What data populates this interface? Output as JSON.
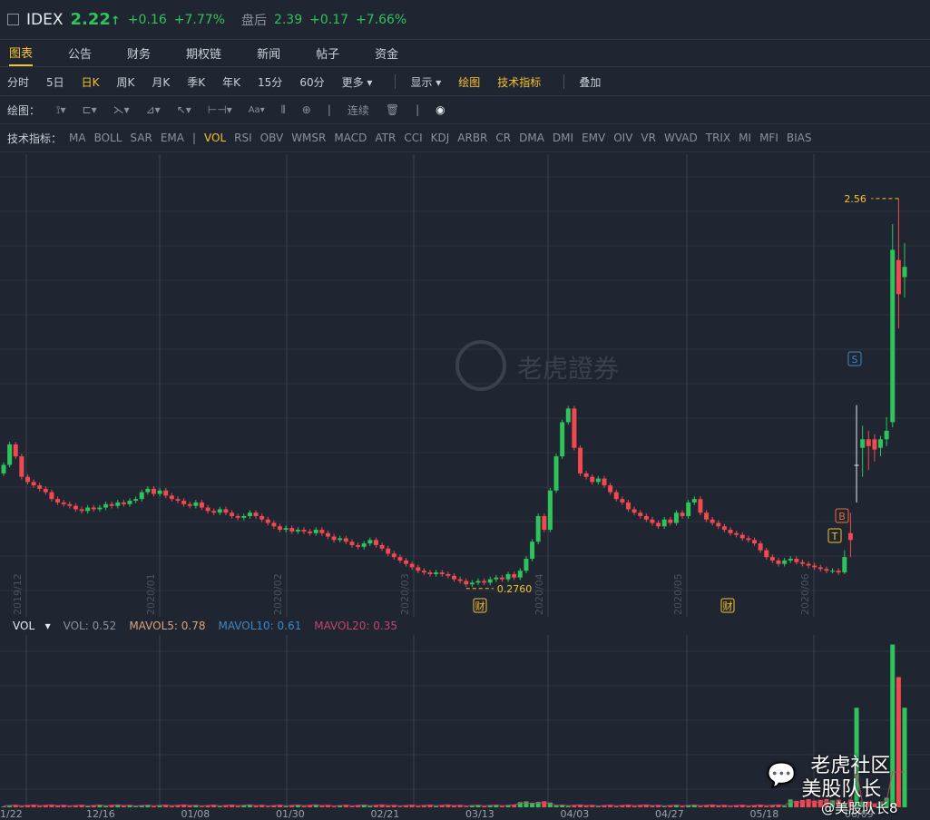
{
  "header": {
    "symbol": "IDEX",
    "price": "2.22",
    "arrow": "↑",
    "change": "+0.16",
    "pct": "+7.77%",
    "after_label": "盘后",
    "after_price": "2.39",
    "after_change": "+0.17",
    "after_pct": "+7.66%"
  },
  "tabs": [
    "图表",
    "公告",
    "财务",
    "期权链",
    "新闻",
    "帖子",
    "资金"
  ],
  "periods": [
    "分时",
    "5日",
    "日K",
    "周K",
    "月K",
    "季K",
    "年K",
    "15分",
    "60分",
    "更多 ▾"
  ],
  "display": [
    "显示 ▾",
    "绘图",
    "技术指标"
  ],
  "overlay": "叠加",
  "draw": {
    "label": "绘图：",
    "continuous": "连续",
    "icons": [
      "vertical-line-icon",
      "rectangle-icon",
      "fib-icon",
      "channel-icon",
      "arrow-icon",
      "measure-icon",
      "text-icon",
      "candle-icon",
      "zoom-icon",
      "trash-icon",
      "eye-icon"
    ]
  },
  "indicators": {
    "label": "技术指标：",
    "items": [
      "MA",
      "BOLL",
      "SAR",
      "EMA",
      "|",
      "VOL",
      "RSI",
      "OBV",
      "WMSR",
      "MACD",
      "ATR",
      "CCI",
      "KDJ",
      "ARBR",
      "CR",
      "DMA",
      "DMI",
      "EMV",
      "OIV",
      "VR",
      "WVAD",
      "TRIX",
      "MI",
      "MFI",
      "BIAS"
    ],
    "active": "VOL"
  },
  "vol_legend": {
    "name": "VOL",
    "vol": "VOL: 0.52",
    "mavol5": "MAVOL5: 0.78",
    "mavol10": "MAVOL10: 0.61",
    "mavol20": "MAVOL20: 0.35"
  },
  "watermark": "老虎證券",
  "overlay_watermark": {
    "line1": "老虎社区",
    "line2": "美股队长",
    "line3": "@美股队长8"
  },
  "colors": {
    "up": "#2fc35b",
    "down": "#f0494f",
    "accent": "#f5c12e",
    "mavol5": "#d9a37a",
    "mavol10": "#3f86c4",
    "mavol20": "#c2456f"
  },
  "chart_data": {
    "type": "candlestick",
    "ylim": [
      0.11,
      2.82
    ],
    "grid": true,
    "month_labels": [
      "2019/12",
      "2020/01",
      "2020/02",
      "2020/03",
      "2020/04",
      "2020/05",
      "2020/06"
    ],
    "x_ticks": [
      "1/22",
      "12/16",
      "01/08",
      "01/30",
      "02/21",
      "03/13",
      "04/03",
      "04/27",
      "05/18",
      "06/09"
    ],
    "high_label": "2.56",
    "low_label": "0.2760",
    "markers": [
      {
        "text": "财",
        "at": "03"
      },
      {
        "text": "财",
        "at": "05"
      },
      {
        "text": "T"
      },
      {
        "text": "B"
      },
      {
        "text": "S"
      }
    ],
    "close": [
      1.0,
      1.12,
      1.05,
      0.93,
      0.9,
      0.88,
      0.86,
      0.84,
      0.8,
      0.78,
      0.77,
      0.76,
      0.74,
      0.73,
      0.75,
      0.74,
      0.75,
      0.77,
      0.76,
      0.78,
      0.77,
      0.79,
      0.8,
      0.84,
      0.86,
      0.83,
      0.85,
      0.82,
      0.8,
      0.79,
      0.77,
      0.76,
      0.78,
      0.75,
      0.73,
      0.72,
      0.74,
      0.72,
      0.7,
      0.69,
      0.7,
      0.72,
      0.7,
      0.68,
      0.66,
      0.64,
      0.62,
      0.63,
      0.61,
      0.62,
      0.61,
      0.6,
      0.62,
      0.6,
      0.58,
      0.56,
      0.57,
      0.55,
      0.53,
      0.52,
      0.54,
      0.56,
      0.53,
      0.51,
      0.48,
      0.46,
      0.44,
      0.42,
      0.4,
      0.38,
      0.37,
      0.36,
      0.37,
      0.36,
      0.35,
      0.33,
      0.32,
      0.3,
      0.31,
      0.32,
      0.31,
      0.33,
      0.34,
      0.33,
      0.36,
      0.34,
      0.38,
      0.45,
      0.55,
      0.7,
      0.62,
      0.85,
      1.05,
      1.25,
      1.33,
      1.1,
      0.95,
      0.93,
      0.9,
      0.92,
      0.88,
      0.84,
      0.8,
      0.78,
      0.74,
      0.72,
      0.7,
      0.68,
      0.66,
      0.64,
      0.68,
      0.66,
      0.72,
      0.7,
      0.78,
      0.8,
      0.72,
      0.68,
      0.66,
      0.64,
      0.62,
      0.6,
      0.59,
      0.57,
      0.56,
      0.54,
      0.5,
      0.46,
      0.44,
      0.42,
      0.44,
      0.45,
      0.43,
      0.42,
      0.41,
      0.4,
      0.39,
      0.38,
      0.38,
      0.37
    ],
    "final_candles": [
      [
        0.37,
        0.5,
        0.36,
        0.46
      ],
      [
        0.6,
        0.72,
        0.46,
        0.56
      ],
      [
        1.0,
        1.35,
        0.78,
        1.0
      ],
      [
        1.1,
        1.23,
        0.93,
        1.15
      ],
      [
        1.15,
        1.2,
        0.97,
        1.11
      ],
      [
        1.15,
        1.18,
        1.02,
        1.09
      ],
      [
        1.1,
        1.17,
        1.05,
        1.15
      ],
      [
        1.15,
        1.28,
        1.11,
        1.2
      ],
      [
        1.25,
        2.41,
        1.22,
        2.26
      ],
      [
        2.2,
        2.56,
        1.8,
        2.0
      ],
      [
        2.1,
        2.3,
        1.98,
        2.16
      ]
    ],
    "volume_ylim": [
      0,
      0.9
    ]
  }
}
